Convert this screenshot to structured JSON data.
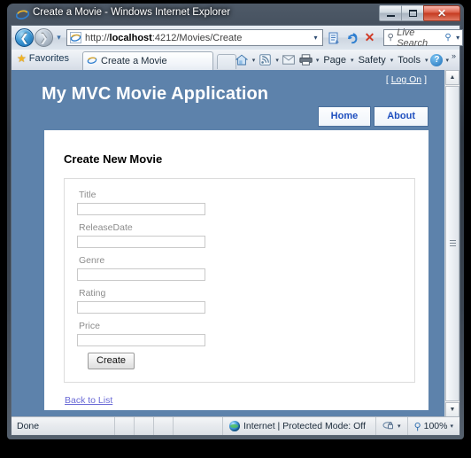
{
  "window": {
    "title": "Create a Movie - Windows Internet Explorer",
    "app_icon": "ie-logo-icon",
    "minimize_label": "Minimize",
    "maximize_label": "Maximize",
    "close_label": "Close"
  },
  "browser": {
    "back_label": "Back",
    "forward_label": "Forward",
    "recent_pages_label": "Recent Pages",
    "address": {
      "url_prefix": "http://",
      "url_host": "localhost",
      "url_suffix": ":4212/Movies/Create",
      "full_url": "http://localhost:4212/Movies/Create",
      "dropdown_label": "Previous Pages"
    },
    "compat_label": "Compatibility View",
    "refresh_label": "Refresh",
    "stop_label": "Stop",
    "search": {
      "placeholder": "Live Search",
      "go_label": "Search",
      "provider_label": "Search Options"
    },
    "favorites_label": "Favorites",
    "tab_title": "Create a Movie",
    "new_tab_label": "New Tab",
    "command_bar": {
      "home_label": "Home",
      "feeds_label": "Feeds",
      "mail_label": "Read Mail",
      "print_label": "Print",
      "page_label": "Page",
      "safety_label": "Safety",
      "tools_label": "Tools",
      "help_label": "Help",
      "overflow_label": "More"
    }
  },
  "page": {
    "logon_prefix": "[",
    "logon_label": "Log On",
    "logon_suffix": "]",
    "site_title": "My MVC Movie Application",
    "menu": [
      {
        "label": "Home"
      },
      {
        "label": "About"
      }
    ],
    "heading": "Create New Movie",
    "form": {
      "fields": [
        {
          "label": "Title",
          "value": ""
        },
        {
          "label": "ReleaseDate",
          "value": ""
        },
        {
          "label": "Genre",
          "value": ""
        },
        {
          "label": "Rating",
          "value": ""
        },
        {
          "label": "Price",
          "value": ""
        }
      ],
      "submit_label": "Create"
    },
    "back_link_label": "Back to List",
    "colors": {
      "header_blue": "#5d82ab",
      "menu_text": "#1f4fbf",
      "link_purple": "#6a6ad6",
      "content_white": "#ffffff",
      "label_gray": "#8c8c8c"
    }
  },
  "status_bar": {
    "text": "Done",
    "zone": "Internet | Protected Mode: Off",
    "zone_icon": "globe-icon",
    "privacy_label": "Privacy Report",
    "zoom_level": "100%",
    "zoom_icon": "magnifier-icon"
  },
  "scrollbar": {
    "up_label": "Scroll Up",
    "down_label": "Scroll Down",
    "thumb_label": "Scroll Thumb"
  }
}
